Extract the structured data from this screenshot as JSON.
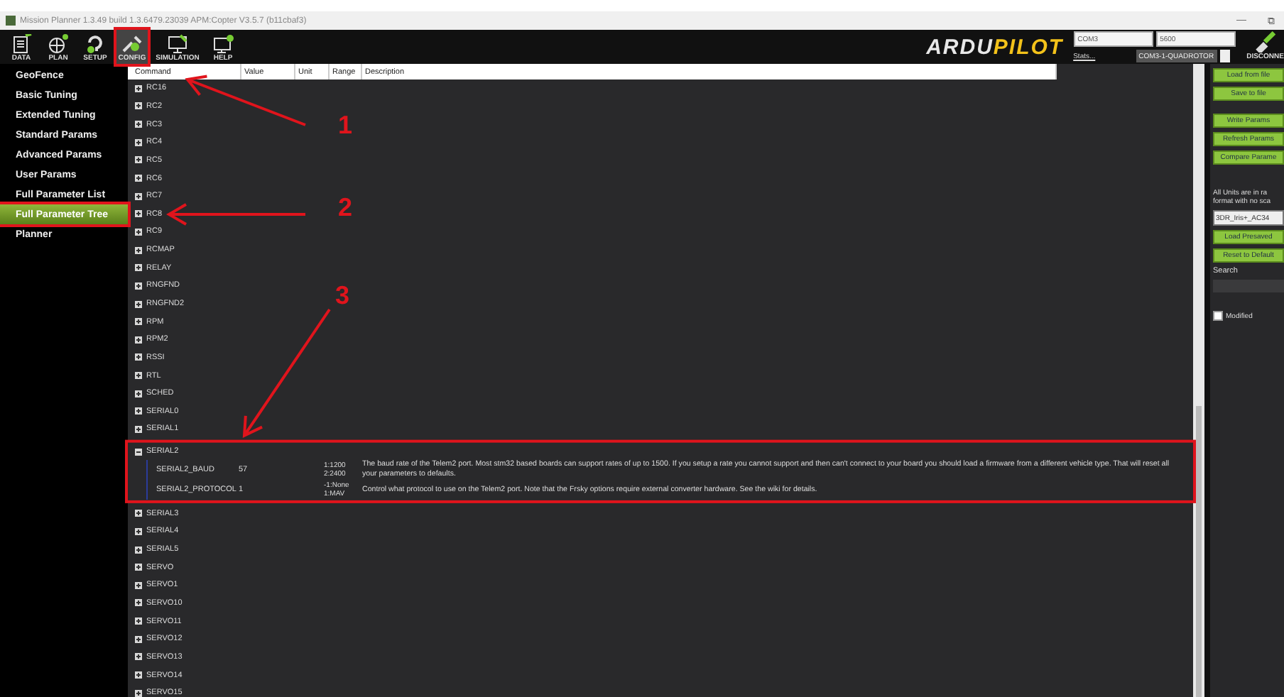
{
  "window": {
    "title": "Mission Planner 1.3.49 build 1.3.6479.23039 APM:Copter V3.5.7 (b11cbaf3)",
    "controls": [
      "—",
      "⧉"
    ]
  },
  "toolbar": {
    "items": [
      {
        "label": "DATA",
        "kind": "data",
        "selected": false
      },
      {
        "label": "PLAN",
        "kind": "plan",
        "selected": false
      },
      {
        "label": "SETUP",
        "kind": "setup",
        "selected": false
      },
      {
        "label": "CONFIG",
        "kind": "config",
        "selected": true
      },
      {
        "label": "SIMULATION",
        "kind": "simulation",
        "selected": false
      },
      {
        "label": "HELP",
        "kind": "help",
        "selected": false
      }
    ],
    "logo": {
      "part_1": "ARDU",
      "part_2": "PILOT"
    },
    "port": "COM3",
    "baud": "5600",
    "stats_link": "Stats...",
    "vehicle": "COM3-1-QUADROTOR",
    "connect_label": "DISCONNE"
  },
  "sidebar": {
    "items": [
      {
        "label": "GeoFence",
        "selected": false
      },
      {
        "label": "Basic Tuning",
        "selected": false
      },
      {
        "label": "Extended Tuning",
        "selected": false
      },
      {
        "label": "Standard Params",
        "selected": false
      },
      {
        "label": "Advanced Params",
        "selected": false
      },
      {
        "label": "User Params",
        "selected": false
      },
      {
        "label": "Full Parameter List",
        "selected": false
      },
      {
        "label": "Full Parameter Tree",
        "selected": true
      },
      {
        "label": "Planner",
        "selected": false
      }
    ]
  },
  "tree": {
    "columns": [
      "Command",
      "Value",
      "Unit",
      "Range",
      "Description"
    ],
    "rows": [
      {
        "label": "RC16",
        "expanded": false
      },
      {
        "label": "RC2",
        "expanded": false
      },
      {
        "label": "RC3",
        "expanded": false
      },
      {
        "label": "RC4",
        "expanded": false
      },
      {
        "label": "RC5",
        "expanded": false
      },
      {
        "label": "RC6",
        "expanded": false
      },
      {
        "label": "RC7",
        "expanded": false
      },
      {
        "label": "RC8",
        "expanded": false
      },
      {
        "label": "RC9",
        "expanded": false
      },
      {
        "label": "RCMAP",
        "expanded": false
      },
      {
        "label": "RELAY",
        "expanded": false
      },
      {
        "label": "RNGFND",
        "expanded": false
      },
      {
        "label": "RNGFND2",
        "expanded": false
      },
      {
        "label": "RPM",
        "expanded": false
      },
      {
        "label": "RPM2",
        "expanded": false
      },
      {
        "label": "RSSI",
        "expanded": false
      },
      {
        "label": "RTL",
        "expanded": false
      },
      {
        "label": "SCHED",
        "expanded": false
      },
      {
        "label": "SERIAL0",
        "expanded": false
      },
      {
        "label": "SERIAL1",
        "expanded": false
      },
      {
        "label": "SERIAL2",
        "expanded": true,
        "children": [
          {
            "command": "SERIAL2_BAUD",
            "value": "57",
            "range": [
              "1:1200",
              "2:2400"
            ],
            "description": "The baud rate of the Telem2 port. Most stm32 based boards can support rates of up to 1500. If you setup a rate you cannot support and then can't connect to your board you should load a firmware from a different vehicle type. That will reset all your parameters to defaults."
          },
          {
            "command": "SERIAL2_PROTOCOL",
            "value": "1",
            "range": [
              "-1:None",
              "1:MAV"
            ],
            "description": "Control what protocol to use on the Telem2 port. Note that the Frsky options require external converter hardware. See the wiki for details."
          }
        ]
      },
      {
        "label": "SERIAL3",
        "expanded": false
      },
      {
        "label": "SERIAL4",
        "expanded": false
      },
      {
        "label": "SERIAL5",
        "expanded": false
      },
      {
        "label": "SERVO",
        "expanded": false
      },
      {
        "label": "SERVO1",
        "expanded": false
      },
      {
        "label": "SERVO10",
        "expanded": false
      },
      {
        "label": "SERVO11",
        "expanded": false
      },
      {
        "label": "SERVO12",
        "expanded": false
      },
      {
        "label": "SERVO13",
        "expanded": false
      },
      {
        "label": "SERVO14",
        "expanded": false
      },
      {
        "label": "SERVO15",
        "expanded": false
      }
    ]
  },
  "right_panel": {
    "buttons_top": [
      "Load from file",
      "Save to file"
    ],
    "buttons_mid": [
      "Write Params",
      "Refresh Params",
      "Compare Parame"
    ],
    "note_lines": [
      "All Units are in ra",
      "format with no sca"
    ],
    "preset": "3DR_Iris+_AC34",
    "buttons_bottom": [
      "Load Presaved",
      "Reset to Default"
    ],
    "search_label": "Search",
    "modified": {
      "label": "Modified",
      "checked": false
    }
  },
  "annotations": [
    {
      "kind": "box"
    },
    {
      "kind": "box"
    },
    {
      "kind": "box"
    },
    {
      "kind": "arrow",
      "label": "1"
    },
    {
      "kind": "arrow",
      "label": "2"
    },
    {
      "kind": "arrow",
      "label": "3"
    }
  ]
}
